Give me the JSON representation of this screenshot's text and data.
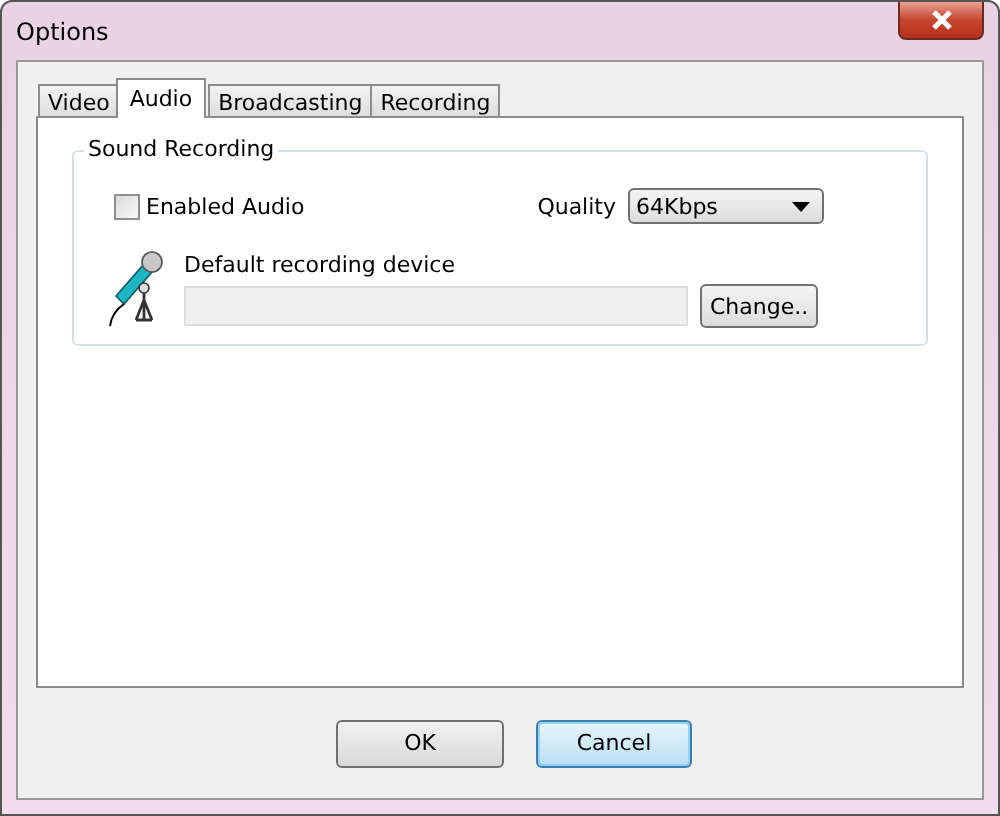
{
  "window": {
    "title": "Options"
  },
  "tabs": [
    {
      "label": "Video",
      "selected": false
    },
    {
      "label": "Audio",
      "selected": true
    },
    {
      "label": "Broadcasting",
      "selected": false
    },
    {
      "label": "Recording",
      "selected": false
    }
  ],
  "group": {
    "title": "Sound Recording",
    "enabled_audio": {
      "label": "Enabled Audio",
      "checked": false
    },
    "quality": {
      "label": "Quality",
      "value": "64Kbps"
    },
    "device": {
      "label": "Default recording device",
      "button": "Change.."
    }
  },
  "buttons": [
    {
      "label": "OK",
      "default": false
    },
    {
      "label": "Cancel",
      "default": true
    }
  ]
}
